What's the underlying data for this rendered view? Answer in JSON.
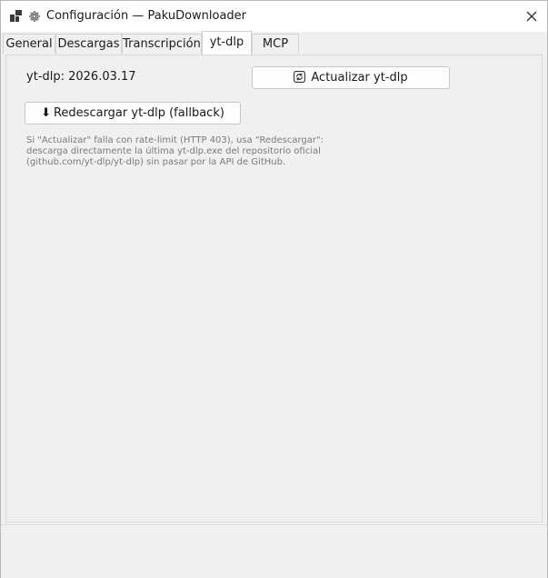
{
  "window": {
    "title": "Configuración — PakuDownloader"
  },
  "tabs": [
    {
      "label": "General"
    },
    {
      "label": "Descargas"
    },
    {
      "label": "Transcripción"
    },
    {
      "label": "yt-dlp",
      "active": true
    },
    {
      "label": "MCP"
    }
  ],
  "ytdlp": {
    "version_label": "yt-dlp: 2026.03.17",
    "update_button": "Actualizar yt-dlp",
    "redownload_arrow": "⬇",
    "redownload_button": "Redescargar yt-dlp (fallback)",
    "hint_lines": [
      "Si \"Actualizar\" falla con rate-limit (HTTP 403), usa \"Redescargar\":",
      "descarga directamente la última yt-dlp.exe del repositorio oficial",
      "(github.com/yt-dlp/yt-dlp) sin pasar por la API de GitHub."
    ]
  },
  "icons": {
    "app": "app-grid-icon",
    "settings": "gear-icon",
    "close": "close-icon",
    "refresh": "refresh-icon"
  },
  "colors": {
    "background": "#f0f0f0",
    "titlebar": "#ffffff",
    "hint_text": "#7a7a7a"
  }
}
